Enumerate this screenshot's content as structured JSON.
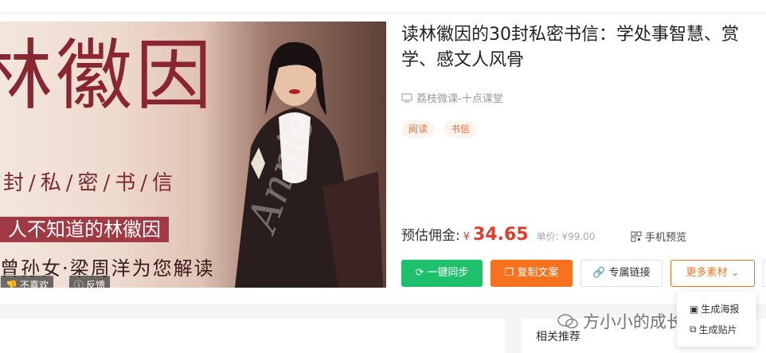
{
  "banner": {
    "big_title": "林徽因",
    "subtitle": "封/私/密/书/信",
    "tagline1": "人不知道的林徽因",
    "tagline2": "曾孙女·梁周洋为您解读",
    "signature": "Annie",
    "dislike_label": "不喜欢",
    "feedback_label": "反馈"
  },
  "course": {
    "title": "读林徽因的30封私密书信：学处事智慧、赏学、感文人风骨",
    "source": "荔枝微课-十点课堂",
    "tags": [
      "阅读",
      "书信"
    ]
  },
  "pricing": {
    "commission_label": "预估佣金:",
    "currency": "¥",
    "commission": "34.65",
    "unit_price": "单价: ¥99.00",
    "preview_label": "手机预览"
  },
  "actions": {
    "sync": "一键同步",
    "copy": "复制文案",
    "link": "专属链接",
    "more": "更多素材"
  },
  "dropdown": {
    "poster": "生成海报",
    "sticker": "生成贴片"
  },
  "sidebar": {
    "related": "相关推荐"
  },
  "watermark": "方小小的成长笔记",
  "colors": {
    "green": "#1ec06b",
    "orange": "#f8721e",
    "price_red": "#e23c2b"
  }
}
